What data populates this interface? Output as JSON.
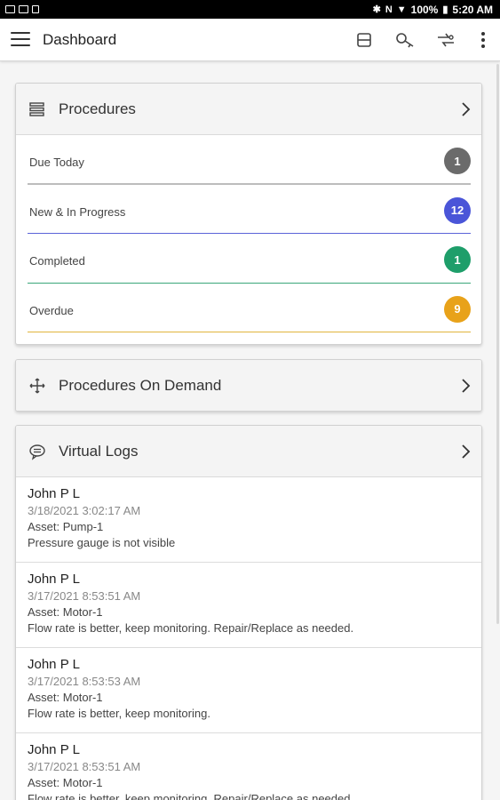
{
  "status_bar": {
    "battery": "100%",
    "time": "5:20 AM"
  },
  "app_bar": {
    "title": "Dashboard",
    "icons": [
      "menu-icon",
      "scanner-icon",
      "key-icon",
      "transfer-icon",
      "more-vert-icon"
    ]
  },
  "procedures": {
    "title": "Procedures",
    "rows": [
      {
        "label": "Due Today",
        "count": "1",
        "color": "#6b6b6b"
      },
      {
        "label": "New & In Progress",
        "count": "12",
        "color": "#4a55d8"
      },
      {
        "label": "Completed",
        "count": "1",
        "color": "#1e9e6a"
      },
      {
        "label": "Overdue",
        "count": "9",
        "color": "#e8a21a"
      }
    ]
  },
  "procedures_on_demand": {
    "title": "Procedures On Demand"
  },
  "virtual_logs": {
    "title": "Virtual Logs",
    "items": [
      {
        "name": "John P L",
        "time": "3/18/2021 3:02:17 AM",
        "asset": "Asset: Pump-1",
        "note": "Pressure gauge is not visible"
      },
      {
        "name": "John P L",
        "time": "3/17/2021 8:53:51 AM",
        "asset": "Asset: Motor-1",
        "note": "Flow rate is better, keep monitoring. Repair/Replace as needed."
      },
      {
        "name": "John P L",
        "time": "3/17/2021 8:53:53 AM",
        "asset": "Asset: Motor-1",
        "note": "Flow rate is better, keep monitoring."
      },
      {
        "name": "John P L",
        "time": "3/17/2021 8:53:51 AM",
        "asset": "Asset: Motor-1",
        "note": "Flow rate is better, keep monitoring. Repair/Replace as needed."
      }
    ]
  }
}
